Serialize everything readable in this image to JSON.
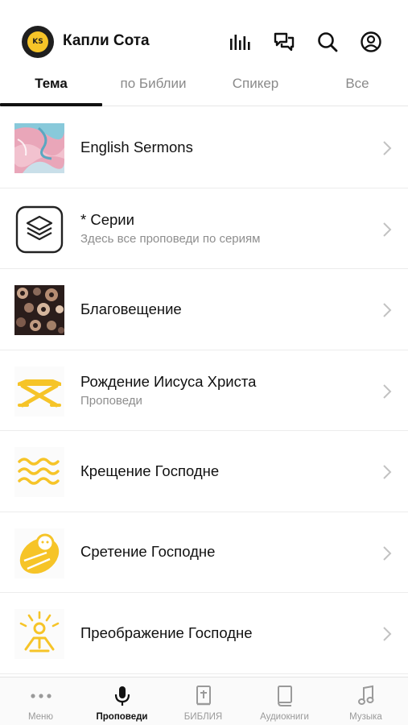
{
  "header": {
    "logo_text": "KS",
    "title": "Капли Сота",
    "icons": [
      "equalizer-icon",
      "chat-icon",
      "search-icon",
      "profile-icon"
    ]
  },
  "tabs": [
    {
      "label": "Тема",
      "active": true
    },
    {
      "label": "по Библии",
      "active": false
    },
    {
      "label": "Спикер",
      "active": false
    },
    {
      "label": "Все",
      "active": false
    }
  ],
  "list": [
    {
      "title": "English Sermons",
      "subtitle": "",
      "icon": "abstract-art-image"
    },
    {
      "title": "* Серии",
      "subtitle": "Здесь все проповеди по сериям",
      "icon": "layers-icon"
    },
    {
      "title": "Благовещение",
      "subtitle": "",
      "icon": "circles-pattern-image"
    },
    {
      "title": "Рождение Иисуса Христа",
      "subtitle": "Проповеди",
      "icon": "manger-icon"
    },
    {
      "title": "Крещение Господне",
      "subtitle": "",
      "icon": "waves-icon"
    },
    {
      "title": "Сретение Господне",
      "subtitle": "",
      "icon": "swaddled-baby-icon"
    },
    {
      "title": "Преображение Господне",
      "subtitle": "",
      "icon": "radiant-figure-icon"
    }
  ],
  "bottom_nav": [
    {
      "label": "Меню",
      "icon": "more-dots-icon",
      "active": false
    },
    {
      "label": "Проповеди",
      "icon": "microphone-icon",
      "active": true
    },
    {
      "label": "БИБЛИЯ",
      "icon": "bible-icon",
      "active": false
    },
    {
      "label": "Аудиокниги",
      "icon": "book-icon",
      "active": false
    },
    {
      "label": "Музыка",
      "icon": "music-note-icon",
      "active": false
    }
  ],
  "colors": {
    "accent_yellow": "#F6C428",
    "active_text": "#111111",
    "inactive_text": "#8A8A8A"
  }
}
